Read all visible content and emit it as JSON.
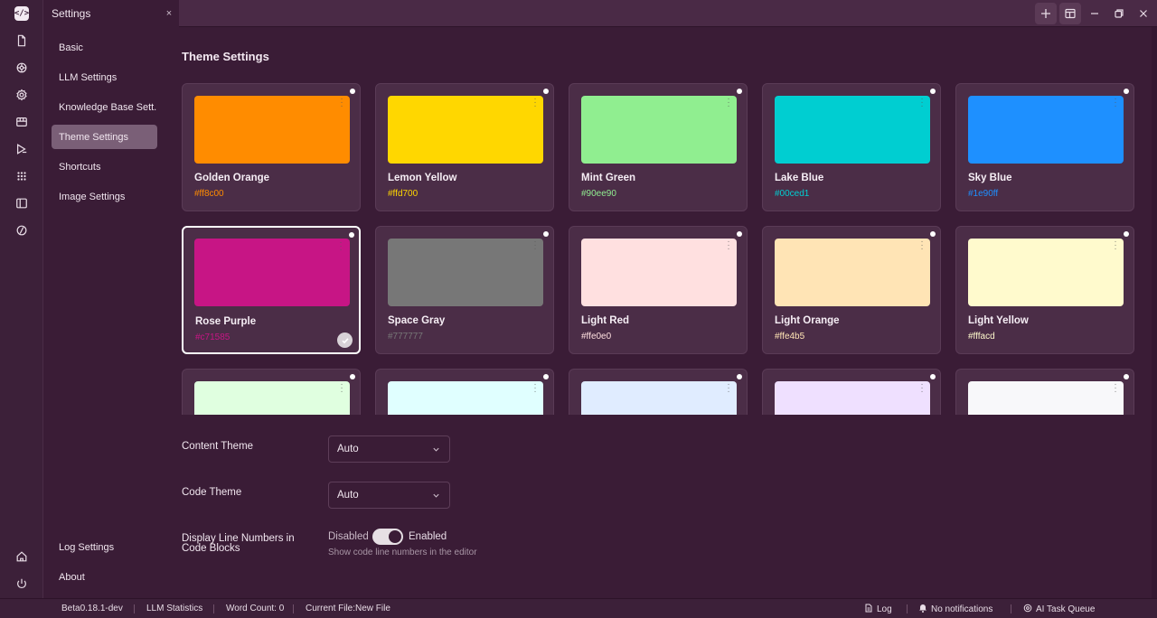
{
  "window": {
    "tab_title": "Settings",
    "tab_close": "×"
  },
  "rail": {
    "logo": "</>",
    "icons": [
      "document-icon",
      "ai-icon",
      "gear-icon",
      "store-icon",
      "tasks-icon",
      "apps-icon",
      "sidebar-icon",
      "slash-icon"
    ],
    "bottom_icons": [
      "home-icon",
      "power-icon"
    ]
  },
  "sidebar": {
    "items": [
      {
        "label": "Basic"
      },
      {
        "label": "LLM Settings"
      },
      {
        "label": "Knowledge Base Sett..."
      },
      {
        "label": "Theme Settings",
        "active": true
      },
      {
        "label": "Shortcuts"
      },
      {
        "label": "Image Settings"
      }
    ],
    "bottom_items": [
      {
        "label": "Log Settings"
      },
      {
        "label": "About"
      }
    ]
  },
  "main": {
    "section_title": "Theme Settings",
    "themes": [
      {
        "name": "Golden Orange",
        "hex": "#ff8c00",
        "color": "#ff8c00"
      },
      {
        "name": "Lemon Yellow",
        "hex": "#ffd700",
        "color": "#ffd700"
      },
      {
        "name": "Mint Green",
        "hex": "#90ee90",
        "color": "#90ee90"
      },
      {
        "name": "Lake Blue",
        "hex": "#00ced1",
        "color": "#00ced1"
      },
      {
        "name": "Sky Blue",
        "hex": "#1e90ff",
        "color": "#1e90ff"
      },
      {
        "name": "Rose Purple",
        "hex": "#c71585",
        "color": "#c71585",
        "selected": true
      },
      {
        "name": "Space Gray",
        "hex": "#777777",
        "color": "#777777"
      },
      {
        "name": "Light Red",
        "hex": "#ffe0e0",
        "color": "#ffe0e0"
      },
      {
        "name": "Light Orange",
        "hex": "#ffe4b5",
        "color": "#ffe4b5"
      },
      {
        "name": "Light Yellow",
        "hex": "#fffacd",
        "color": "#fffacd"
      },
      {
        "name": "",
        "hex": "",
        "color": "#e0ffe0"
      },
      {
        "name": "",
        "hex": "",
        "color": "#e0ffff"
      },
      {
        "name": "",
        "hex": "",
        "color": "#e0ecff"
      },
      {
        "name": "",
        "hex": "",
        "color": "#efe0ff"
      },
      {
        "name": "",
        "hex": "",
        "color": "#f8f8fa"
      }
    ],
    "content_theme": {
      "label": "Content Theme",
      "value": "Auto"
    },
    "code_theme": {
      "label": "Code Theme",
      "value": "Auto"
    },
    "line_numbers": {
      "label": "Display Line Numbers in Code Blocks",
      "off_label": "Disabled",
      "on_label": "Enabled",
      "enabled": true,
      "hint": "Show code line numbers in the editor"
    }
  },
  "status": {
    "version": "Beta0.18.1-dev",
    "llm_stats": "LLM Statistics",
    "word_count": "Word Count: 0",
    "current_file": "Current File:New File",
    "log": "Log",
    "notifications": "No notifications",
    "task_queue": "AI Task Queue"
  }
}
